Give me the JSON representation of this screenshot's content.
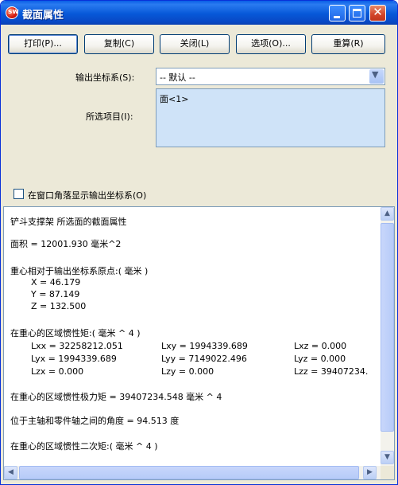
{
  "window": {
    "title": "截面属性"
  },
  "titlebar": {
    "app_icon_name": "solidworks-icon",
    "min_glyph": "",
    "max_glyph": "",
    "close_glyph": "✕"
  },
  "toolbar": {
    "print": "打印(P)...",
    "copy": "复制(C)",
    "close": "关闭(L)",
    "options": "选项(O)...",
    "recalc": "重算(R)"
  },
  "form": {
    "output_cs_label": "输出坐标系(S):",
    "output_cs_value": "-- 默认 --",
    "selected_label": "所选项目(I):",
    "selected_items": [
      "面<1>"
    ],
    "show_cs_label": "在窗口角落显示输出坐标系(O)",
    "show_cs_checked": false
  },
  "results": {
    "header": "铲斗支撑架 所选面的截面属性",
    "area": "面积 = 12001.930 毫米^2",
    "centroid_title": "重心相对于输出坐标系原点:(  毫米  )",
    "centroid": [
      "X = 46.179",
      "Y = 87.149",
      "Z = 132.500"
    ],
    "inertia_title": "在重心的区域惯性矩:(  毫米 ^ 4  )",
    "inertia_rows": [
      [
        "Lxx = 32258212.051",
        "Lxy = 1994339.689",
        "Lxz = 0.000"
      ],
      [
        "Lyx = 1994339.689",
        "Lyy = 7149022.496",
        "Lyz = 0.000"
      ],
      [
        "Lzx = 0.000",
        "Lzy = 0.000",
        "Lzz = 39407234."
      ]
    ],
    "polar": "在重心的区域惯性极力矩 = 39407234.548 毫米 ^ 4",
    "angle": "位于主轴和零件轴之间的角度 = 94.513 度",
    "second_moment": "在重心的区域惯性二次矩:(  毫米 ^ 4  )"
  },
  "scrollbars": {
    "up": "▲",
    "down": "▼",
    "left": "◀",
    "right": "▶"
  },
  "colors": {
    "titlebar": "#0758d8",
    "dialog_bg": "#ece9d8",
    "list_selection_bg": "#cfe3f8"
  }
}
